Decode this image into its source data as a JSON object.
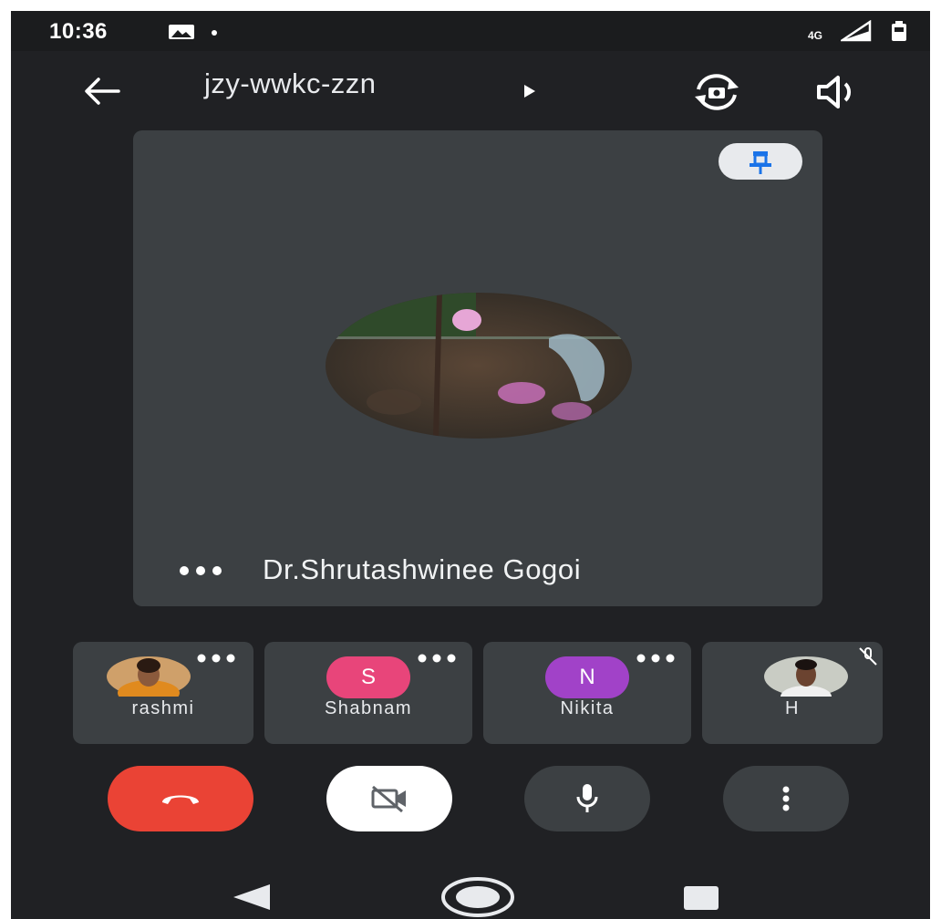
{
  "status_bar": {
    "time": "10:36",
    "network": "4G",
    "icons": [
      "gallery-notification-icon",
      "signal-icon",
      "battery-icon"
    ]
  },
  "top_bar": {
    "meeting_code": "jzy-wwkc-zzn",
    "icons": [
      "back-arrow-icon",
      "play-arrow-icon",
      "camera-switch-icon",
      "speaker-icon"
    ]
  },
  "main_tile": {
    "presenter_name": "Dr.Shrutashwinee Gogoi",
    "pin_icon": "pin-icon",
    "more_icon": "more-horizontal-icon"
  },
  "participants": [
    {
      "name": "rashmi",
      "avatar": "photo",
      "has_more": true
    },
    {
      "name": "Shabnam",
      "avatar_letter": "S",
      "avatar_color": "#e8457a",
      "has_more": true
    },
    {
      "name": "Nikita",
      "avatar_letter": "N",
      "avatar_color": "#a142c8",
      "has_more": true
    },
    {
      "name": "H",
      "avatar": "photo",
      "muted": true
    }
  ],
  "controls": {
    "end_call_color": "#ea4335",
    "icons": [
      "end-call-icon",
      "camera-off-icon",
      "microphone-icon",
      "more-vertical-icon"
    ]
  },
  "nav_bar": {
    "icons": [
      "nav-back-icon",
      "nav-home-icon",
      "nav-recents-icon"
    ]
  }
}
